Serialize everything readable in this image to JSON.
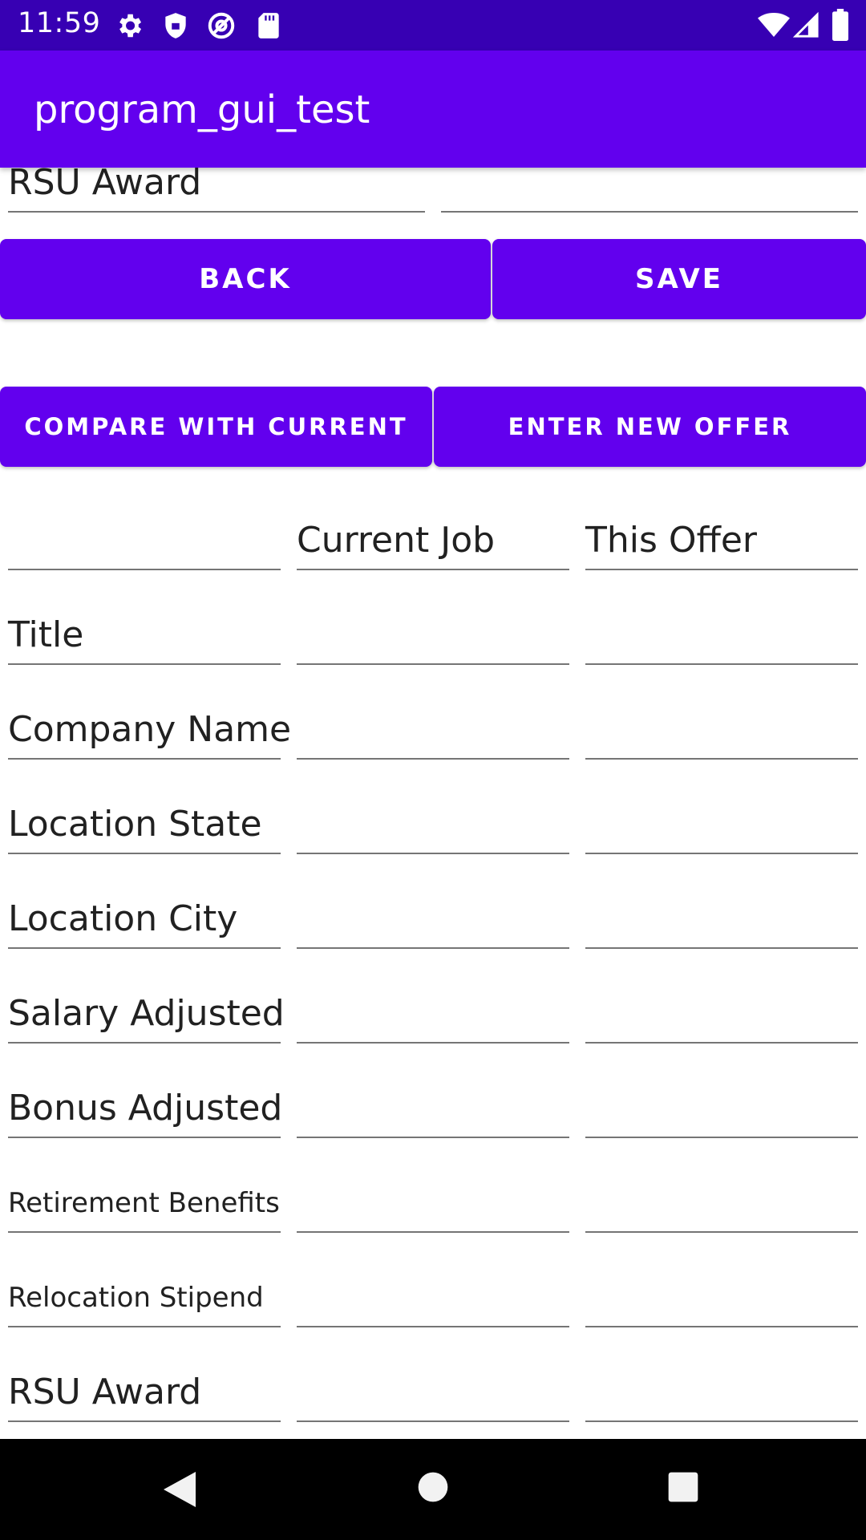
{
  "status_bar": {
    "time": "11:59",
    "icons": [
      "settings-gear-icon",
      "shield-icon",
      "at-sync-icon",
      "sd-card-icon",
      "wifi-icon",
      "signal-icon",
      "battery-icon"
    ]
  },
  "app_bar": {
    "title": "program_gui_test"
  },
  "top_partial": {
    "label": "RSU Award"
  },
  "buttons": {
    "back": "BACK",
    "save": "SAVE",
    "compare": "COMPARE WITH CURRENT",
    "enter_new": "ENTER NEW OFFER"
  },
  "table": {
    "headers": {
      "current": "Current Job",
      "offer": "This Offer"
    },
    "rows": [
      {
        "label": "Title"
      },
      {
        "label": "Company Name"
      },
      {
        "label": "Location State"
      },
      {
        "label": "Location City"
      },
      {
        "label": "Salary Adjusted"
      },
      {
        "label": "Bonus Adjusted"
      },
      {
        "label": "Retirement Benefits"
      },
      {
        "label": "Relocation Stipend"
      },
      {
        "label": "RSU Award"
      }
    ]
  },
  "colors": {
    "primary": "#6200EE",
    "primary_dark": "#3700B3",
    "on_primary": "#FFFFFF"
  },
  "nav_bar": {
    "icons": [
      "back-triangle-icon",
      "home-circle-icon",
      "recents-square-icon"
    ]
  }
}
